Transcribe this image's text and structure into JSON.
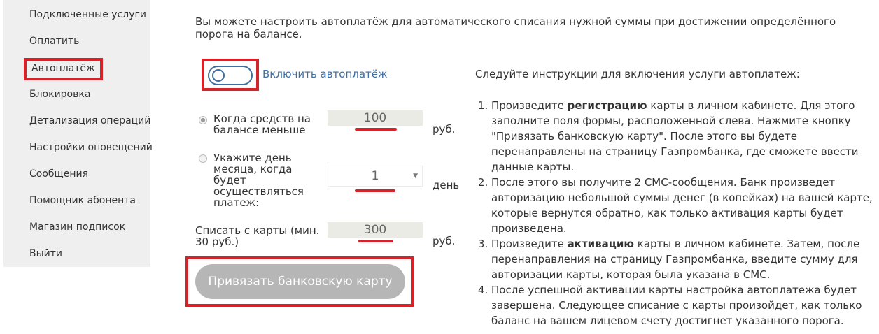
{
  "sidebar": {
    "items": [
      {
        "label": "Подключенные услуги"
      },
      {
        "label": "Оплатить"
      },
      {
        "label": "Автоплатёж",
        "active": true
      },
      {
        "label": "Блокировка"
      },
      {
        "label": "Детализация операций"
      },
      {
        "label": "Настройки оповещений"
      },
      {
        "label": "Сообщения"
      },
      {
        "label": "Помощник абонента"
      },
      {
        "label": "Магазин подписок"
      },
      {
        "label": "Выйти"
      }
    ]
  },
  "intro": "Вы можете настроить автоплатёж для автоматического списания нужной суммы при достижении определённого порога на балансе.",
  "toggle": {
    "label": "Включить автоплатёж",
    "on": false
  },
  "form": {
    "threshold": {
      "label": "Когда средств на балансе меньше",
      "value": "100",
      "unit": "руб.",
      "selected": true
    },
    "day": {
      "label": "Укажите день месяца, когда будет осуществляться платеж:",
      "value": "1",
      "unit": "день",
      "selected": false
    },
    "charge": {
      "label": "Списать с карты (мин. 30 руб.)",
      "value": "300",
      "unit": "руб."
    }
  },
  "bind_button": {
    "label": "Привязать банковскую карту"
  },
  "instructions": {
    "heading": "Следуйте инструкции для включения услуги автоплатеж:",
    "steps": [
      {
        "pre": "Произведите ",
        "bold": "регистрацию",
        "post": " карты в личном кабинете. Для этого заполните поля формы, расположенной слева. Нажмите кнопку \"Привязать банковскую карту\". После этого вы будете перенаправлены на страницу Газпромбанка, где сможете ввести данные карты."
      },
      {
        "pre": "После этого вы получите 2 СМС-сообщения. Банк произведет авторизацию небольшой суммы денег (в копейках) на вашей карте, которые вернутся обратно, как только активация карты будет произведена.",
        "bold": "",
        "post": ""
      },
      {
        "pre": "Произведите ",
        "bold": "активацию",
        "post": " карты в личном кабинете. Затем, после перенаправления на страницу Газпромбанка, введите сумму для авторизации карты, которая была указана в СМС."
      },
      {
        "pre": "После успешной активации карты настройка автоплатежа будет завершена. Следующее списание с карты произойдет, как только баланс на вашем лицевом счету достигнет указанного порога.",
        "bold": "",
        "post": ""
      }
    ]
  },
  "colors": {
    "highlight": "#d4242a",
    "link": "#3d6ea5",
    "button": "#b6b6b6",
    "sidebar_bg": "#efefef"
  }
}
